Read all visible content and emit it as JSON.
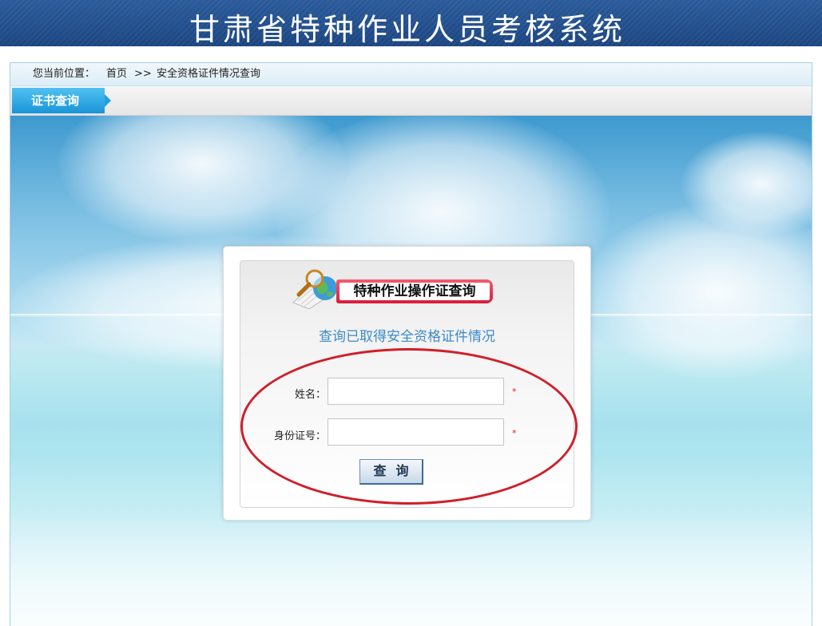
{
  "header": {
    "title": "甘肃省特种作业人员考核系统"
  },
  "breadcrumb": {
    "prefix": "您当前位置：",
    "home": "首页",
    "separator": ">>",
    "current": "安全资格证件情况查询"
  },
  "tabs": [
    {
      "label": "证书查询",
      "active": true
    }
  ],
  "panel": {
    "logo_text": "特种作业操作证查询",
    "subtitle": "查询已取得安全资格证件情况",
    "fields": [
      {
        "label": "姓名：",
        "value": "",
        "required_mark": "*"
      },
      {
        "label": "身份证号：",
        "value": "",
        "required_mark": "*"
      }
    ],
    "submit_label": "查询"
  },
  "colors": {
    "header_bg": "#1b4580",
    "tab_active": "#1a94d8",
    "subtitle": "#3c8ac8",
    "annotation_ellipse": "#cf1f2a",
    "required_mark": "#e02020"
  },
  "icons": {
    "logo": "magnifier-globe-icon"
  }
}
